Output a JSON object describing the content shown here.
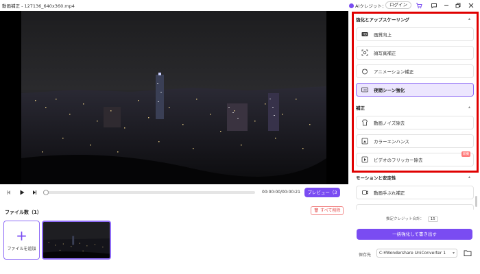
{
  "window": {
    "title": "動画補正 - 127136_640x360.mp4",
    "ai_credit": "AIクレジット：",
    "login": "ログイン"
  },
  "player": {
    "time": "00:00:00/00:00:21",
    "preview_label": "プレビュー（3秒）",
    "progress": 0.0
  },
  "files": {
    "count_label": "ファイル数（1）",
    "delete_all": "すべて削除",
    "add_label": "ファイルを追加"
  },
  "panel": {
    "section_enhance": "強化とアップスケーリング",
    "enhance_items": [
      {
        "label": "画質向上",
        "icon": "hd-icon"
      },
      {
        "label": "顔写真補正",
        "icon": "face-icon"
      },
      {
        "label": "アニメーション補正",
        "icon": "anime-icon"
      },
      {
        "label": "夜間シーン強化",
        "icon": "night-hd-icon",
        "selected": true
      }
    ],
    "section_correct": "補正",
    "correct_items": [
      {
        "label": "動画ノイズ除去",
        "icon": "noise-icon"
      },
      {
        "label": "カラーエンハンス",
        "icon": "color-icon"
      },
      {
        "label": "ビデオのフリッカー除去",
        "icon": "flicker-icon",
        "badge": "新機"
      }
    ],
    "section_motion": "モーションと安定性",
    "motion_items": [
      {
        "label": "動画手ぶれ補正",
        "icon": "stabilize-icon"
      }
    ]
  },
  "footer": {
    "estimate_label": "推定クレジット合計：",
    "estimate_value": "15",
    "batch_button": "一括強化して書き出す",
    "save_label": "保存先",
    "save_path": "C:¥Wondershare UniConverter 1"
  },
  "colors": {
    "accent": "#7a4cf2",
    "highlight_frame": "#e00000"
  }
}
